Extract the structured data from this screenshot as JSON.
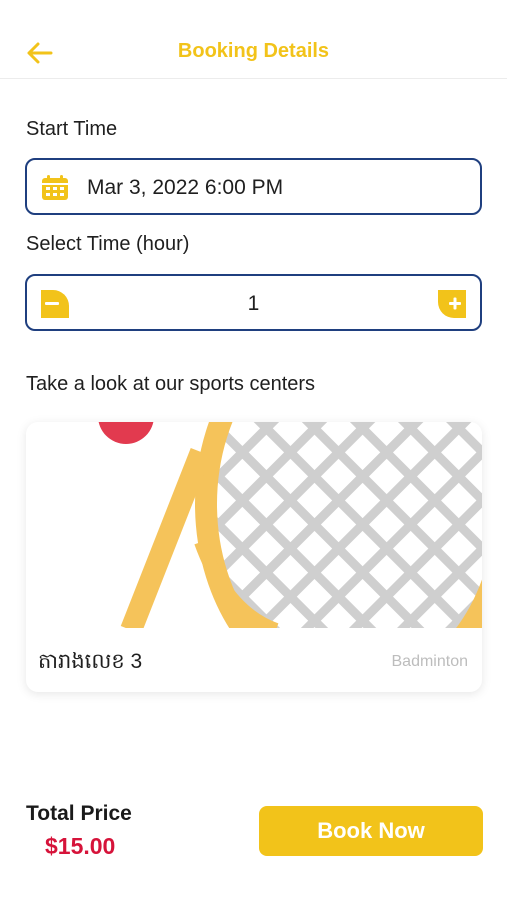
{
  "header": {
    "title": "Booking Details",
    "back_icon": "arrow-left-icon"
  },
  "start_time": {
    "label": "Start Time",
    "value": "Mar 3, 2022 6:00 PM",
    "icon": "calendar-icon"
  },
  "duration": {
    "label": "Select Time (hour)",
    "value": "1",
    "minus_icon": "minus-icon",
    "plus_icon": "plus-icon"
  },
  "centers": {
    "heading": "Take a look at our sports centers",
    "items": [
      {
        "name": "តារាងលេខ 3",
        "type": "Badminton",
        "image_icon": "tennis-racket-illustration"
      }
    ]
  },
  "footer": {
    "total_label": "Total Price",
    "total_value": "$15.00",
    "book_label": "Book Now"
  },
  "colors": {
    "accent": "#f2c31a",
    "field_border": "#1f3f7f",
    "price": "#d6133a"
  }
}
